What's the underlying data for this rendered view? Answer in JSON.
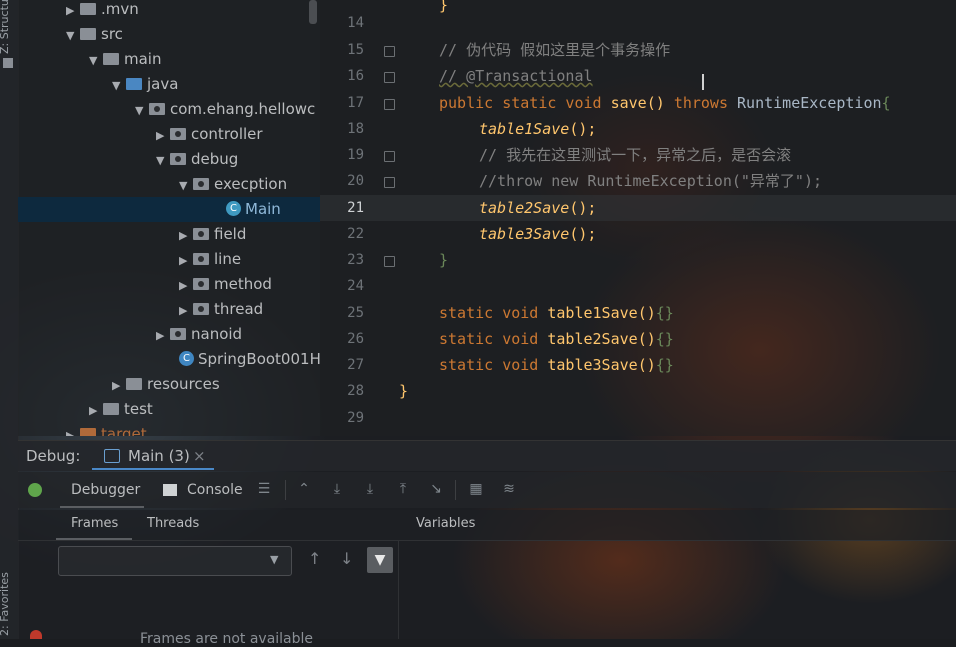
{
  "left_strip": {
    "structure_label": "Z: Structure",
    "favorites_label": "2: Favorites"
  },
  "project_tree": [
    {
      "label": ".mvn",
      "type": "folder",
      "expanded": false
    },
    {
      "label": "src",
      "type": "folder",
      "expanded": true
    },
    {
      "label": "main",
      "type": "folder",
      "expanded": true
    },
    {
      "label": "java",
      "type": "source-folder",
      "expanded": true
    },
    {
      "label": "com.ehang.hellowc",
      "type": "package",
      "expanded": true
    },
    {
      "label": "controller",
      "type": "package",
      "expanded": false
    },
    {
      "label": "debug",
      "type": "package",
      "expanded": true
    },
    {
      "label": "execption",
      "type": "package",
      "expanded": true
    },
    {
      "label": "Main",
      "type": "class",
      "selected": true
    },
    {
      "label": "field",
      "type": "package",
      "expanded": false
    },
    {
      "label": "line",
      "type": "package",
      "expanded": false
    },
    {
      "label": "method",
      "type": "package",
      "expanded": false
    },
    {
      "label": "thread",
      "type": "package",
      "expanded": false
    },
    {
      "label": "nanoid",
      "type": "package",
      "expanded": false
    },
    {
      "label": "SpringBoot001H",
      "type": "class"
    },
    {
      "label": "resources",
      "type": "folder",
      "expanded": false
    },
    {
      "label": "test",
      "type": "folder",
      "expanded": false
    },
    {
      "label": "target",
      "type": "folder",
      "expanded": false
    }
  ],
  "editor": {
    "current_line": "21",
    "lines": [
      {
        "num": "14",
        "text": "}"
      },
      {
        "num": "15",
        "text": "// 伪代码 假如这里是个事务操作"
      },
      {
        "num": "16",
        "text": "// @Transactional"
      },
      {
        "num": "17",
        "kw1": "public static void ",
        "fn": "save",
        "p1": "() ",
        "kw2": "throws ",
        "rest": "RuntimeException",
        "brace": "{"
      },
      {
        "num": "18",
        "it": "table1Save",
        "p": "();"
      },
      {
        "num": "19",
        "text": "// 我先在这里测试一下，异常之后，是否会滚"
      },
      {
        "num": "20",
        "text": "//throw new RuntimeException(\"异常了\");"
      },
      {
        "num": "21",
        "it": "table2Save",
        "p": "();"
      },
      {
        "num": "22",
        "it": "table3Save",
        "p": "();"
      },
      {
        "num": "23",
        "text": "}"
      },
      {
        "num": "24",
        "text": ""
      },
      {
        "num": "25",
        "kw": "static void ",
        "fn": "table1Save",
        "p": "()",
        "braces": "{}"
      },
      {
        "num": "26",
        "kw": "static void ",
        "fn": "table2Save",
        "p": "()",
        "braces": "{}"
      },
      {
        "num": "27",
        "kw": "static void ",
        "fn": "table3Save",
        "p": "()",
        "braces": "{}"
      },
      {
        "num": "28",
        "text": "}"
      },
      {
        "num": "29",
        "text": ""
      }
    ]
  },
  "debug_panel": {
    "label": "Debug:",
    "session_tab": "Main (3)",
    "close_glyph": "×",
    "tabs": {
      "debugger": "Debugger",
      "console": "Console"
    },
    "subtabs": {
      "frames": "Frames",
      "threads": "Threads",
      "variables": "Variables"
    },
    "frames_status": "Frames are not available"
  },
  "colors": {
    "keyword": "#cc7832",
    "function": "#ffc66d",
    "comment": "#808080",
    "selection": "#0d293e",
    "accent": "#4a88c7"
  }
}
